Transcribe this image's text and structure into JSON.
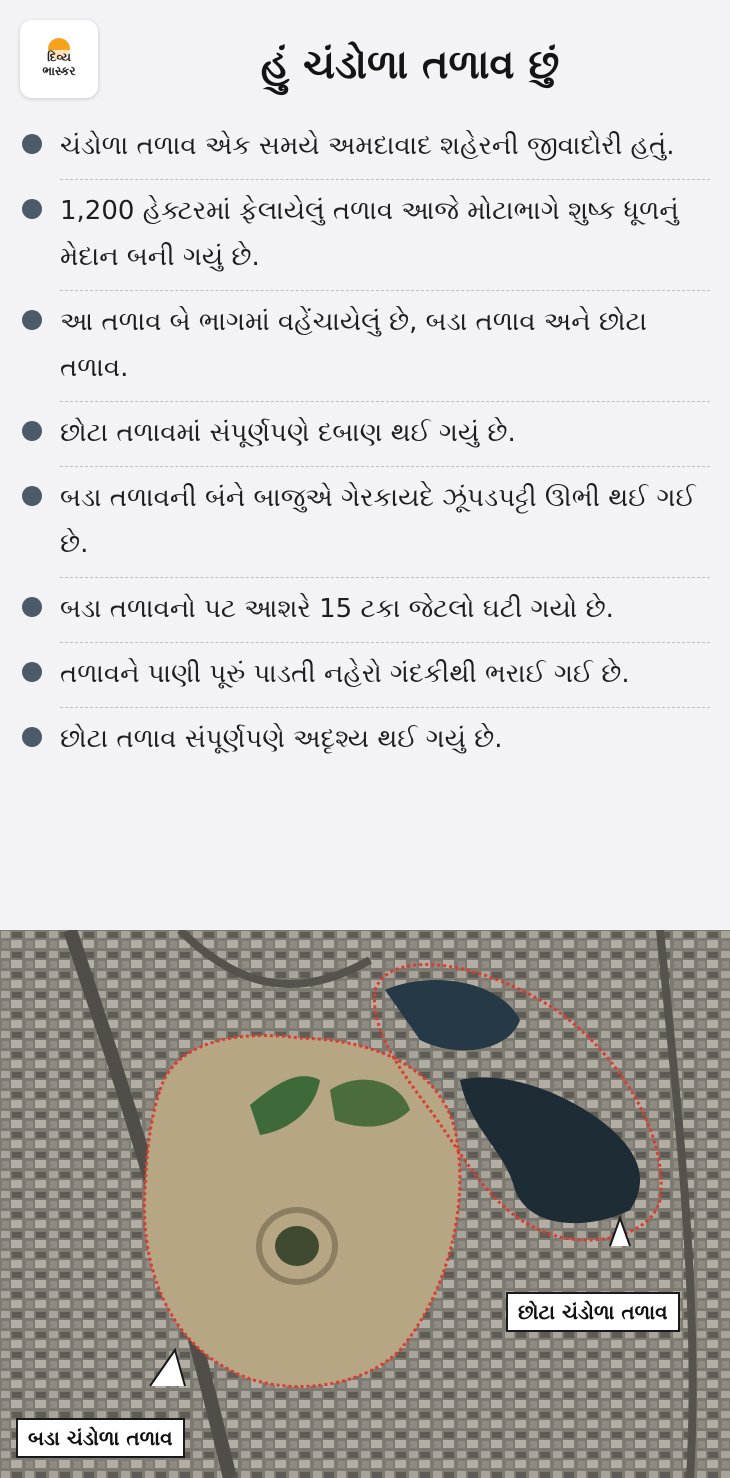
{
  "logo": {
    "line1": "દિવ્ય",
    "line2": "ભાસ્કર",
    "sun_color": "#f6a21c"
  },
  "title": "હું ચંડોળા તળાવ છું",
  "bullets": [
    "ચંડોળા તળાવ એક સમયે અમદાવાદ શહેરની જીવાદોરી હતું.",
    "1,200 હેક્ટરમાં ફેલાયેલું તળાવ આજે મોટાભાગે શુષ્ક ધૂળનું મેદાન બની ગયું છે.",
    "આ તળાવ બે ભાગમાં વહેંચાયેલું છે, બડા તળાવ અને છોટા તળાવ.",
    "છોટા તળાવમાં સંપૂર્ણપણે દબાણ થઈ ગયું છે.",
    "બડા તળાવની બંને બાજુએ ગેરકાયદે ઝૂંપડપટ્ટી ઊભી થઈ ગઈ છે.",
    "બડા તળાવનો પટ આશરે 15 ટકા જેટલો ઘટી ગયો છે.",
    "તળાવને પાણી પૂરું પાડતી નહેરો ગંદકીથી ભરાઈ ગઈ છે.",
    "છોટા તળાવ સંપૂર્ણપણે અદૃશ્ય થઈ ગયું છે."
  ],
  "map": {
    "small_lake_label": "છોટા ચંડોળા તળાવ",
    "big_lake_label": "બડા ચંડોળા તળાવ",
    "boundary_color": "#e03a2e"
  },
  "colors": {
    "background": "#f3f3f5",
    "bullet": "#4c5b68"
  }
}
